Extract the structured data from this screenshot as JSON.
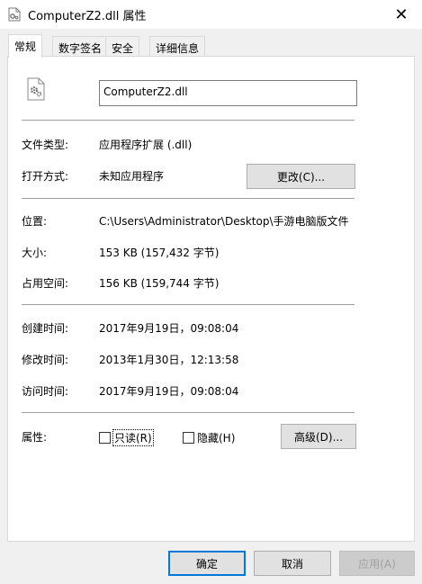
{
  "window": {
    "title": "ComputerZ2.dll 属性",
    "close_glyph": "✕"
  },
  "tabs": [
    {
      "label": "常规",
      "active": true
    },
    {
      "label": "数字签名",
      "active": false
    },
    {
      "label": "安全",
      "active": false
    },
    {
      "label": "详细信息",
      "active": false
    }
  ],
  "general": {
    "file_name": "ComputerZ2.dll",
    "file_type_label": "文件类型:",
    "file_type_value": "应用程序扩展 (.dll)",
    "open_with_label": "打开方式:",
    "open_with_value": "未知应用程序",
    "change_button": "更改(C)...",
    "location_label": "位置:",
    "location_value": "C:\\Users\\Administrator\\Desktop\\手游电脑版文件",
    "size_label": "大小:",
    "size_value": "153 KB (157,432 字节)",
    "size_on_disk_label": "占用空间:",
    "size_on_disk_value": "156 KB (159,744 字节)",
    "created_label": "创建时间:",
    "created_value": "2017年9月19日，09:08:04",
    "modified_label": "修改时间:",
    "modified_value": "2013年1月30日，12:13:58",
    "accessed_label": "访问时间:",
    "accessed_value": "2017年9月19日，09:08:04",
    "attributes_label": "属性:",
    "readonly_label": "只读(R)",
    "readonly_checked": false,
    "hidden_label": "隐藏(H)",
    "hidden_checked": false,
    "advanced_button": "高级(D)..."
  },
  "footer": {
    "ok_button": "确定",
    "cancel_button": "取消",
    "apply_button": "应用(A)"
  },
  "colors": {
    "accent": "#0078d7",
    "dialog_bg": "#f0f0f0",
    "button_bg": "#e1e1e1",
    "separator": "#a0a0a0"
  },
  "icons": {
    "title": "dll-file-icon",
    "file": "dll-gear-file-icon",
    "close": "close-icon"
  }
}
